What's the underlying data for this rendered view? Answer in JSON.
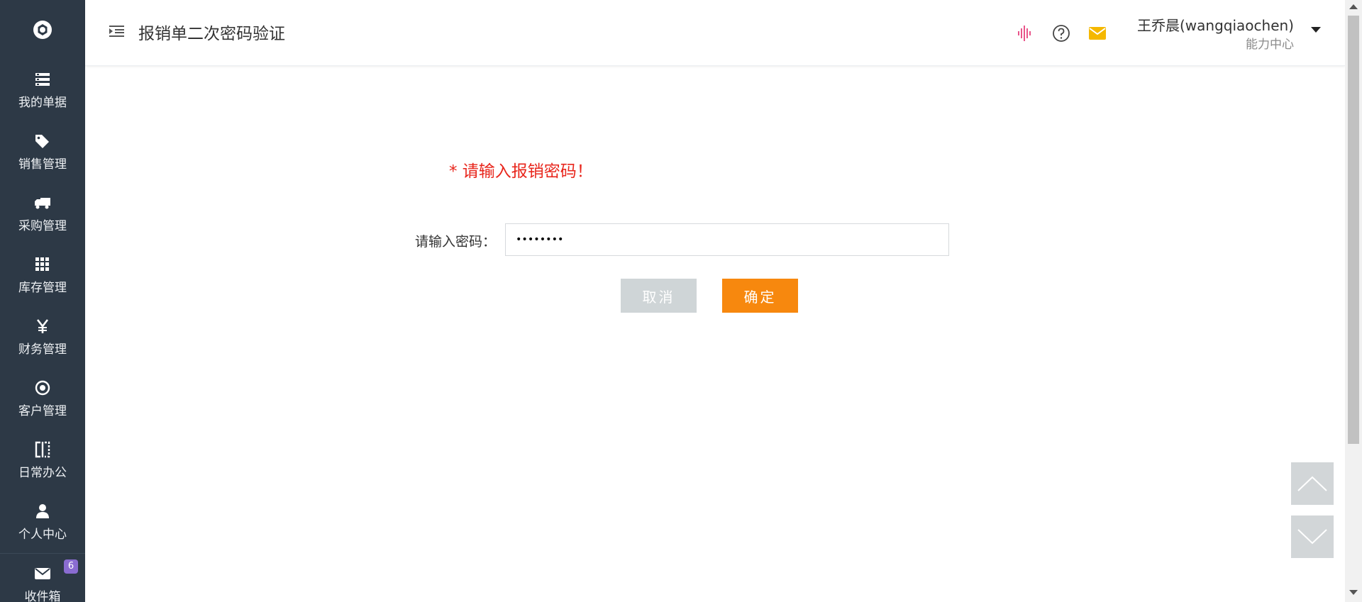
{
  "sidebar": {
    "logo_icon": "gear-logo-icon",
    "items": [
      {
        "label": "我的单据",
        "icon": "list-icon"
      },
      {
        "label": "销售管理",
        "icon": "tag-icon"
      },
      {
        "label": "采购管理",
        "icon": "truck-icon"
      },
      {
        "label": "库存管理",
        "icon": "grid-icon"
      },
      {
        "label": "财务管理",
        "icon": "yen-icon"
      },
      {
        "label": "客户管理",
        "icon": "target-icon"
      },
      {
        "label": "日常办公",
        "icon": "columns-icon"
      },
      {
        "label": "个人中心",
        "icon": "user-icon"
      },
      {
        "label": "收件箱",
        "icon": "mail-icon",
        "badge": "6"
      }
    ]
  },
  "header": {
    "title": "报销单二次密码验证",
    "user_name": "王乔晨(wangqiaochen)",
    "user_dept": "能力中心",
    "icons": [
      "voice-icon",
      "help-icon",
      "message-icon"
    ]
  },
  "main": {
    "notice": "* 请输入报销密码！",
    "password_label": "请输入密码：",
    "password_value": "••••••••",
    "cancel_label": "取消",
    "ok_label": "确定"
  },
  "colors": {
    "sidebar_bg": "#2d3946",
    "accent_orange": "#f7880e",
    "notice_red": "#e8261c",
    "voice_pink": "#e9558a",
    "mail_yellow": "#f5b800"
  }
}
